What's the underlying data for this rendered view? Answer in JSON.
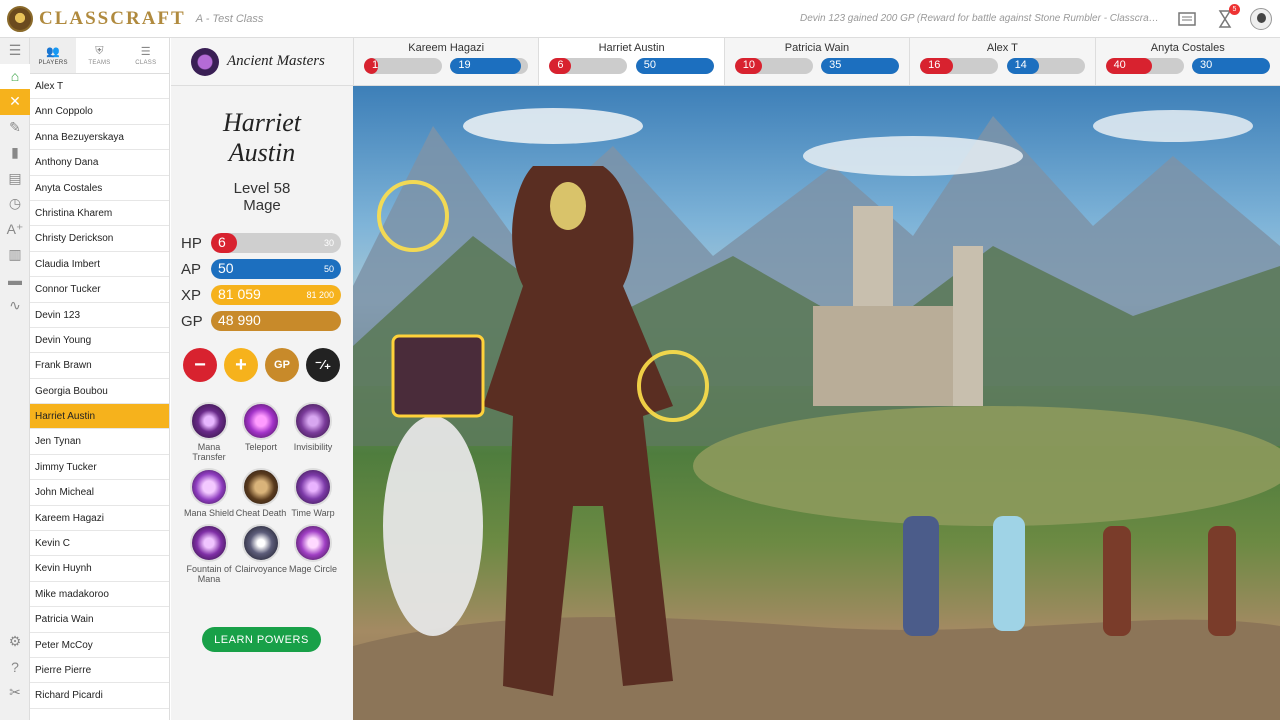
{
  "app": {
    "name": "CLASSCRAFT",
    "class_name": "A - Test Class"
  },
  "notification": "Devin 123 gained 200 GP (Reward for battle against Stone Rumbler - Classcraft Boss)",
  "notification_badge": "5",
  "tabs": [
    {
      "label": "PLAYERS"
    },
    {
      "label": "TEAMS"
    },
    {
      "label": "CLASS"
    }
  ],
  "players": [
    "Alex T",
    "Ann Coppolo",
    "Anna Bezuyerskaya",
    "Anthony Dana",
    "Anyta Costales",
    "Christina Kharem",
    "Christy Derickson",
    "Claudia Imbert",
    "Connor Tucker",
    "Devin 123",
    "Devin Young",
    "Frank Brawn",
    "Georgia Boubou",
    "Harriet Austin",
    "Jen Tynan",
    "Jimmy Tucker",
    "John Micheal",
    "Kareem Hagazi",
    "Kevin C",
    "Kevin Huynh",
    "Mike madakoroo",
    "Patricia Wain",
    "Peter McCoy",
    "Pierre Pierre",
    "Richard Picardi"
  ],
  "team": {
    "name": "Ancient Masters",
    "members": [
      {
        "name": "Kareem Hagazi",
        "hp": 1,
        "ap": 19,
        "hp_fill": 0.18,
        "ap_fill": 0.9
      },
      {
        "name": "Harriet Austin",
        "hp": 6,
        "ap": 50,
        "hp_fill": 0.28,
        "ap_fill": 1.0
      },
      {
        "name": "Patricia Wain",
        "hp": 10,
        "ap": 35,
        "hp_fill": 0.35,
        "ap_fill": 1.0
      },
      {
        "name": "Alex T",
        "hp": 16,
        "ap": 14,
        "hp_fill": 0.42,
        "ap_fill": 0.42
      },
      {
        "name": "Anyta Costales",
        "hp": 40,
        "ap": 30,
        "hp_fill": 0.6,
        "ap_fill": 1.0
      }
    ]
  },
  "character": {
    "name_line1": "Harriet",
    "name_line2": "Austin",
    "level": "Level 58",
    "class": "Mage",
    "stats": {
      "hp": {
        "label": "HP",
        "value": "6",
        "max": "30",
        "fill": 0.2,
        "color": "#d8222f"
      },
      "ap": {
        "label": "AP",
        "value": "50",
        "max": "50",
        "fill": 1.0,
        "color": "#1c6fbf"
      },
      "xp": {
        "label": "XP",
        "value": "81 059",
        "max": "81 200",
        "fill": 0.998,
        "color": "#f6b21c"
      },
      "gp": {
        "label": "GP",
        "value": "48 990",
        "fill": 1.0,
        "color": "#c88a2a"
      }
    },
    "actions": {
      "gp_label": "GP"
    },
    "powers": [
      {
        "label": "Mana Transfer"
      },
      {
        "label": "Teleport"
      },
      {
        "label": "Invisibility"
      },
      {
        "label": "Mana Shield"
      },
      {
        "label": "Cheat Death"
      },
      {
        "label": "Time Warp"
      },
      {
        "label": "Fountain of Mana"
      },
      {
        "label": "Clairvoyance"
      },
      {
        "label": "Mage Circle"
      }
    ],
    "learn_label": "LEARN POWERS"
  }
}
